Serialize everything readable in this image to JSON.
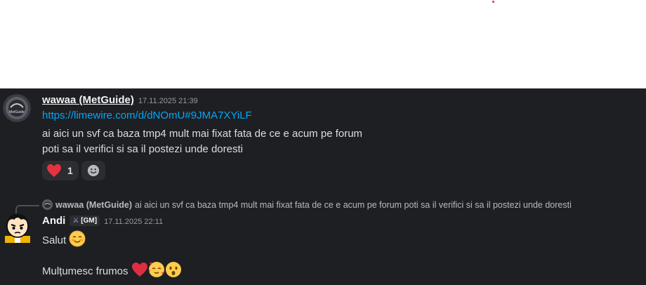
{
  "messages": [
    {
      "author": "wawaa (MetGuide)",
      "timestamp": "17.11.2025 21:39",
      "link": "https://limewire.com/d/dNOmU#9JMA7XYiLF",
      "lines": [
        "ai aici un svf ca baza tmp4 mult mai fixat fata de ce e acum pe forum",
        "poti sa il verifici si sa il postezi unde doresti"
      ],
      "reactions": [
        {
          "icon": "heart-icon",
          "count": "1"
        },
        {
          "icon": "add-reaction-icon"
        }
      ]
    },
    {
      "reply": {
        "author": "wawaa (MetGuide)",
        "text": "ai aici un svf ca baza tmp4 mult mai fixat fata de ce e acum pe forum poti sa il verifici si sa il postezi unde doresti"
      },
      "author": "Andi",
      "tag": "[GM]",
      "timestamp": "17.11.2025 22:11",
      "lines": [
        "Salut",
        "Mulțumesc frumos"
      ],
      "emojis": [
        "smiling-face-icon",
        "heart-icon",
        "smiling-face-with-hearts-icon",
        "surprised-face-icon"
      ]
    }
  ],
  "colors": {
    "background": "#1e1f22",
    "link": "#00a8fc",
    "text": "#dbdee1",
    "heart": "#e5323f"
  }
}
